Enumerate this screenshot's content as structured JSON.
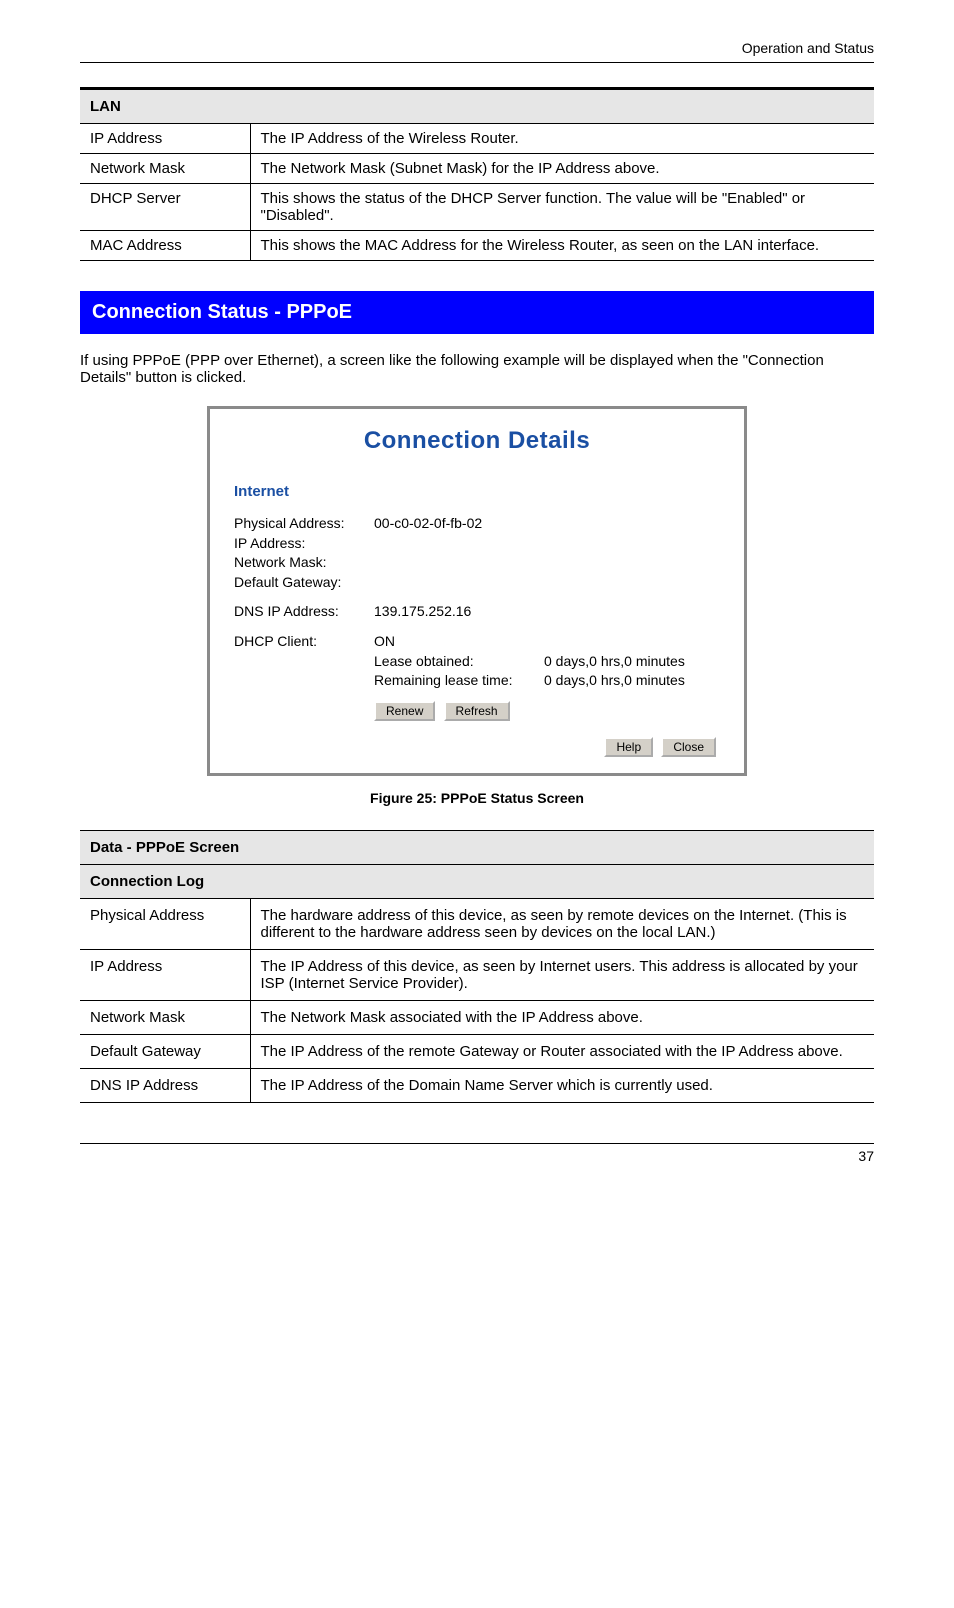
{
  "header_right": "Operation and Status",
  "table1": {
    "header": "LAN",
    "rows": [
      {
        "label": "IP Address",
        "value": "The IP Address of the Wireless Router."
      },
      {
        "label": "Network Mask",
        "value": "The Network Mask (Subnet Mask) for the IP Address above."
      },
      {
        "label": "DHCP Server",
        "value": "This shows the status of the DHCP Server function. The value will be \"Enabled\" or \"Disabled\"."
      },
      {
        "label": "MAC Address",
        "value": "This shows the MAC Address for the Wireless Router, as seen on the LAN interface."
      }
    ]
  },
  "blue_bar": "Connection Status - PPPoE",
  "intro": "If using PPPoE (PPP over Ethernet), a screen like the following example will be displayed when the \"Connection Details\" button is clicked.",
  "shot": {
    "title": "Connection Details",
    "subhead": "Internet",
    "rows_block1": [
      {
        "k": "Physical Address:",
        "v": "00-c0-02-0f-fb-02"
      },
      {
        "k": "IP Address:",
        "v": ""
      },
      {
        "k": "Network Mask:",
        "v": ""
      },
      {
        "k": "Default Gateway:",
        "v": ""
      }
    ],
    "rows_block2": [
      {
        "k": "DNS IP Address:",
        "v": "139.175.252.16"
      }
    ],
    "rows_block3": [
      {
        "k": "DHCP Client:",
        "v": "ON"
      }
    ],
    "subrows": [
      {
        "sk": "Lease obtained:",
        "sv": "0 days,0 hrs,0 minutes"
      },
      {
        "sk": "Remaining lease time:",
        "sv": "0 days,0 hrs,0 minutes"
      }
    ],
    "btn_renew": "Renew",
    "btn_refresh": "Refresh",
    "btn_help": "Help",
    "btn_close": "Close"
  },
  "fig_caption": "Figure 25: PPPoE Status Screen",
  "table2": {
    "header": "Data - PPPoE Screen",
    "header2": "Connection Log",
    "rows": [
      {
        "label": "Physical Address",
        "value": "The hardware address of this device, as seen by remote devices on the Internet. (This is different to the hardware address seen by devices on the local LAN.)"
      },
      {
        "label": "IP Address",
        "value": "The IP Address of this device, as seen by Internet users. This address is allocated by your ISP (Internet Service Provider)."
      },
      {
        "label": "Network Mask",
        "value": "The Network Mask associated with the IP Address above."
      },
      {
        "label": "Default Gateway",
        "value": "The IP Address of the remote Gateway or Router associated with the IP Address above."
      },
      {
        "label": "DNS IP Address",
        "value": "The IP Address of the Domain Name Server which is currently used."
      }
    ]
  },
  "page_num": "37"
}
